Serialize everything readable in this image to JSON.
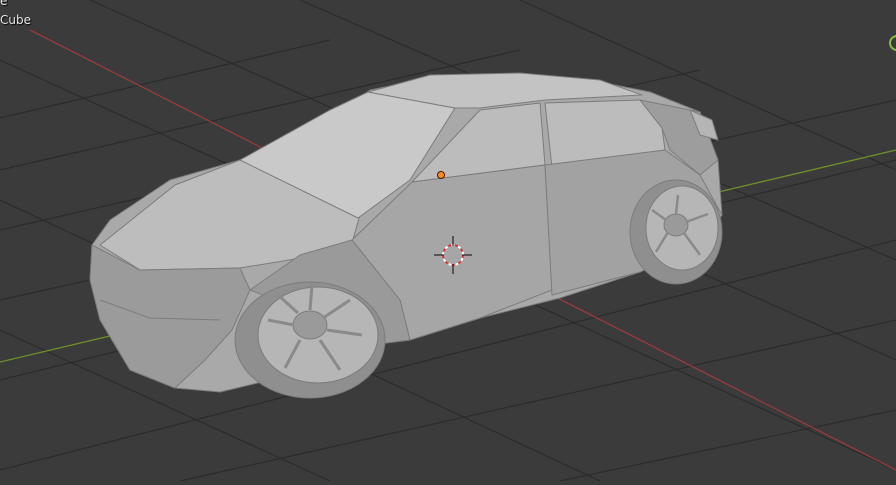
{
  "viewport": {
    "hud_line1": "e",
    "hud_line2": "Cube",
    "scene_object": "car-model",
    "background_color": "#3b3b3b",
    "grid_color": "#2a2a2a",
    "x_axis_color": "#a03a3a",
    "y_axis_color": "#6f8f2a",
    "model_color": "#a8a8a8",
    "origin_color": "#ff8c1a",
    "cursor_color": "#e03030"
  }
}
